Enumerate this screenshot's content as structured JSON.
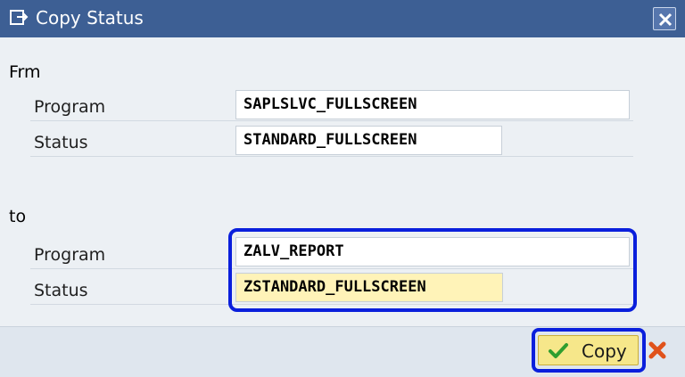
{
  "window": {
    "title": "Copy Status",
    "close_icon": "close-icon"
  },
  "from_section": {
    "label": "Frm",
    "program_label": "Program",
    "program_value": "SAPLSLVC_FULLSCREEN",
    "status_label": "Status",
    "status_value": "STANDARD_FULLSCREEN"
  },
  "to_section": {
    "label": "to",
    "program_label": "Program",
    "program_value": "ZALV_REPORT",
    "status_label": "Status",
    "status_value": "ZSTANDARD_FULLSCREEN"
  },
  "footer": {
    "copy_label": "Copy",
    "copy_icon": "checkmark-icon",
    "cancel_icon": "cancel-icon"
  },
  "colors": {
    "titlebar": "#3d5f94",
    "highlight": "#0a1fdc",
    "active_field": "#fff3b8",
    "copy_button": "#f6e78a"
  }
}
